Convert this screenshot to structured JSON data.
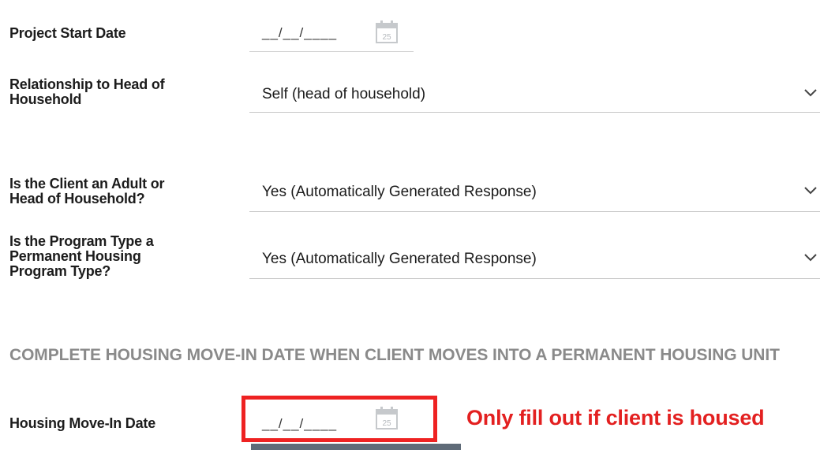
{
  "fields": {
    "project_start_date": {
      "label": "Project Start Date",
      "value": "__/__/____"
    },
    "relationship": {
      "label_line1": "Relationship to Head of",
      "label_line2": "Household",
      "value": "Self (head of household)"
    },
    "client_adult": {
      "label_line1": "Is the Client an Adult or",
      "label_line2": "Head of Household?",
      "value": "Yes (Automatically Generated Response)"
    },
    "program_type": {
      "label_line1": "Is the Program Type a",
      "label_line2": "Permanent Housing",
      "label_line3": "Program Type?",
      "value": "Yes (Automatically Generated Response)"
    },
    "housing_move_in_date": {
      "label": "Housing Move-In Date",
      "value": "__/__/____"
    }
  },
  "section": {
    "header": "COMPLETE HOUSING MOVE-IN DATE WHEN CLIENT MOVES INTO A PERMANENT HOUSING UNIT"
  },
  "annotation": {
    "text": "Only fill out if client is housed",
    "color": "#e32020"
  },
  "calendar": {
    "day": "25"
  },
  "icons": {
    "calendar": "calendar-icon",
    "dropdown": "chevron-down-icon"
  }
}
